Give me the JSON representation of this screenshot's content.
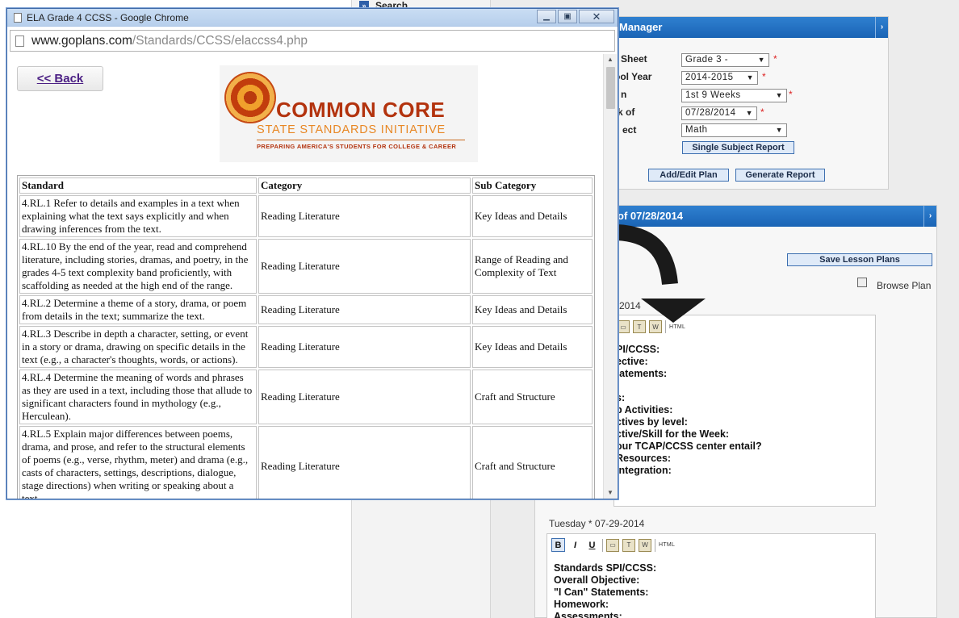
{
  "nav": {
    "search_label": "Search"
  },
  "manager": {
    "title_fragment": "Manager",
    "labels": [
      "Sheet",
      "ool Year",
      "n",
      "k of",
      "ect"
    ],
    "grade": "Grade 3 -",
    "school_year": "2014-2015",
    "period": "1st 9 Weeks",
    "week_of": "07/28/2014",
    "subject": "Math",
    "single_subject_report": "Single Subject Report",
    "add_edit_plan": "Add/Edit Plan",
    "generate_report": "Generate Report"
  },
  "lessons": {
    "title_fragment": "of 07/28/2014",
    "save_lesson_plans": "Save Lesson Plans",
    "browse_plan": "Browse Plan",
    "monday_fragment": "-2014",
    "monday_lines": [
      "PI/CCSS:",
      "ective:",
      "tatements:",
      "",
      "s:",
      "p Activities:",
      "ctives by level:",
      "ctive/Skill for the Week:",
      "our TCAP/CCSS center entail?",
      "Resources:",
      "Integration:"
    ],
    "tuesday_label": "Tuesday * 07-29-2014",
    "tuesday_lines": [
      "Standards SPI/CCSS:",
      "Overall Objective:",
      "\"I Can\" Statements:",
      "Homework:",
      "Assessments:"
    ],
    "toolbar": {
      "bold": "B",
      "italic": "I",
      "underline": "U",
      "html": "HTML"
    }
  },
  "popup": {
    "window_title": "ELA Grade 4 CCSS - Google Chrome",
    "url_host": "www.goplans.com",
    "url_path": "/Standards/CCSS/elaccss4.php",
    "back_label": "<< Back",
    "logo": {
      "line1": "COMMON CORE",
      "line2": "STATE STANDARDS INITIATIVE",
      "line3": "PREPARING AMERICA'S STUDENTS FOR COLLEGE & CAREER"
    },
    "table": {
      "headers": [
        "Standard",
        "Category",
        "Sub Category"
      ],
      "rows": [
        [
          "4.RL.1 Refer to details and examples in a text when explaining what the text says explicitly and when drawing inferences from the text.",
          "Reading Literature",
          "Key Ideas and Details"
        ],
        [
          "4.RL.10 By the end of the year, read and comprehend literature, including stories, dramas, and poetry, in the grades 4-5 text complexity band proficiently, with scaffolding as needed at the high end of the range.",
          "Reading Literature",
          "Range of Reading and Complexity of Text"
        ],
        [
          "4.RL.2 Determine a theme of a story, drama, or poem from details in the text; summarize the text.",
          "Reading Literature",
          "Key Ideas and Details"
        ],
        [
          "4.RL.3 Describe in depth a character, setting, or event in a story or drama, drawing on specific details in the text (e.g., a character's thoughts, words, or actions).",
          "Reading Literature",
          "Key Ideas and Details"
        ],
        [
          "4.RL.4 Determine the meaning of words and phrases as they are used in a text, including those that allude to significant characters found in mythology (e.g., Herculean).",
          "Reading Literature",
          "Craft and Structure"
        ],
        [
          "4.RL.5 Explain major differences between poems, drama, and prose, and refer to the structural elements of poems (e.g., verse, rhythm, meter) and drama (e.g., casts of characters, settings, descriptions, dialogue, stage directions) when writing or speaking about a text.",
          "Reading Literature",
          "Craft and Structure"
        ]
      ]
    }
  }
}
